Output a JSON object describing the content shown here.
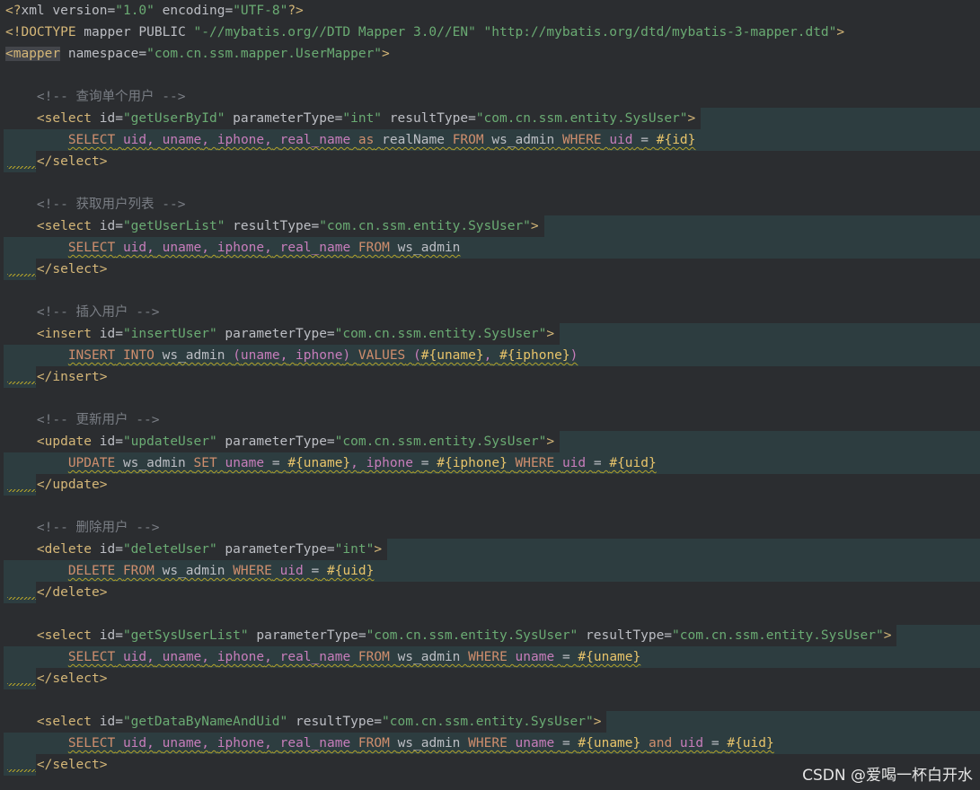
{
  "header": {
    "xml_decl": [
      "<?",
      "xml version=",
      "\"1.0\"",
      " encoding=",
      "\"UTF-8\"",
      "?>"
    ],
    "doctype": [
      "<!DOCTYPE",
      " mapper PUBLIC ",
      "\"-//mybatis.org//DTD Mapper 3.0//EN\"",
      " ",
      "\"http://mybatis.org/dtd/mybatis-3-mapper.dtd\"",
      ">"
    ],
    "mapper_open": [
      "<mapper",
      " namespace=",
      "\"com.cn.ssm.mapper.UserMapper\"",
      ">"
    ]
  },
  "blocks": [
    {
      "comment": "<!-- 查询单个用户 -->",
      "open": [
        "<select",
        " id=",
        "\"getUserById\"",
        " parameterType=",
        "\"int\"",
        " resultType=",
        "\"com.cn.ssm.entity.SysUser\"",
        ">"
      ],
      "sql": "SELECT uid, uname, iphone, real_name as realName FROM ws_admin WHERE uid = #{id}",
      "close": "</select>"
    },
    {
      "comment": "<!-- 获取用户列表 -->",
      "open": [
        "<select",
        " id=",
        "\"getUserList\"",
        " resultType=",
        "\"com.cn.ssm.entity.SysUser\"",
        ">"
      ],
      "sql": "SELECT uid, uname, iphone, real_name FROM ws_admin",
      "close": "</select>"
    },
    {
      "comment": "<!-- 插入用户 -->",
      "open": [
        "<insert",
        " id=",
        "\"insertUser\"",
        " parameterType=",
        "\"com.cn.ssm.entity.SysUser\"",
        ">"
      ],
      "sql": "INSERT INTO ws_admin (uname, iphone) VALUES (#{uname}, #{iphone})",
      "close": "</insert>"
    },
    {
      "comment": "<!-- 更新用户 -->",
      "open": [
        "<update",
        " id=",
        "\"updateUser\"",
        " parameterType=",
        "\"com.cn.ssm.entity.SysUser\"",
        ">"
      ],
      "sql": "UPDATE ws_admin SET uname = #{uname}, iphone = #{iphone} WHERE uid = #{uid}",
      "close": "</update>"
    },
    {
      "comment": "<!-- 删除用户 -->",
      "open": [
        "<delete",
        " id=",
        "\"deleteUser\"",
        " parameterType=",
        "\"int\"",
        ">"
      ],
      "sql": "DELETE FROM ws_admin WHERE uid = #{uid}",
      "close": "</delete>"
    },
    {
      "comment": "",
      "open": [
        "<select",
        " id=",
        "\"getSysUserList\"",
        " parameterType=",
        "\"com.cn.ssm.entity.SysUser\"",
        " resultType=",
        "\"com.cn.ssm.entity.SysUser\"",
        ">"
      ],
      "sql": "SELECT uid, uname, iphone, real_name FROM ws_admin WHERE uname = #{uname}",
      "close": "</select>"
    },
    {
      "comment": "",
      "open": [
        "<select",
        " id=",
        "\"getDataByNameAndUid\"",
        " resultType=",
        "\"com.cn.ssm.entity.SysUser\"",
        ">"
      ],
      "sql": "SELECT uid, uname, iphone, real_name FROM ws_admin WHERE uname = #{uname} and uid = #{uid}",
      "close": "</select>"
    }
  ],
  "watermark": "CSDN @爱喝一杯白开水"
}
